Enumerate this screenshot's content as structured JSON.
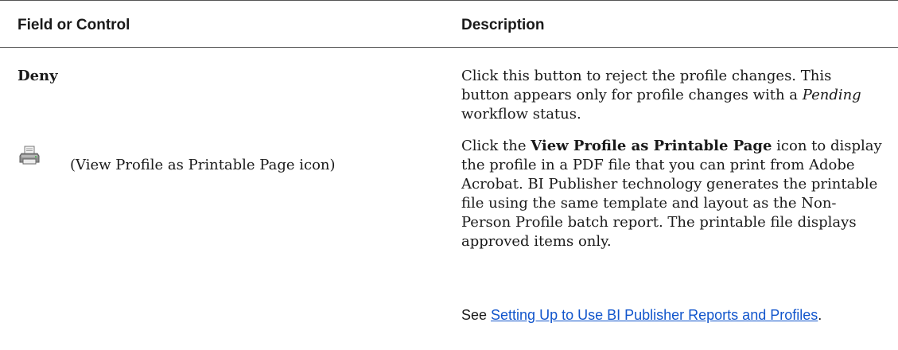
{
  "table": {
    "headers": {
      "field": "Field or Control",
      "description": "Description"
    },
    "rows": [
      {
        "field": "Deny",
        "description": {
          "text1": "Click this button to reject the profile changes. This button appears only for profile changes with a ",
          "emphasis": "Pending",
          "text2": " workflow status."
        }
      },
      {
        "icon": "printer-icon",
        "field": "(View Profile as Printable Page icon)",
        "description": {
          "text1": "Click the ",
          "strong": "View Profile as Printable Page",
          "text2": " icon to display the profile in a PDF file that you can print from Adobe Acrobat. BI Publisher technology generates the printable file using the same template and layout as the Non-Person Profile batch report. The printable file displays approved items only.",
          "see_prefix": "See ",
          "see_link": "Setting Up to Use BI Publisher Reports and Profiles",
          "see_suffix": "."
        }
      }
    ]
  }
}
